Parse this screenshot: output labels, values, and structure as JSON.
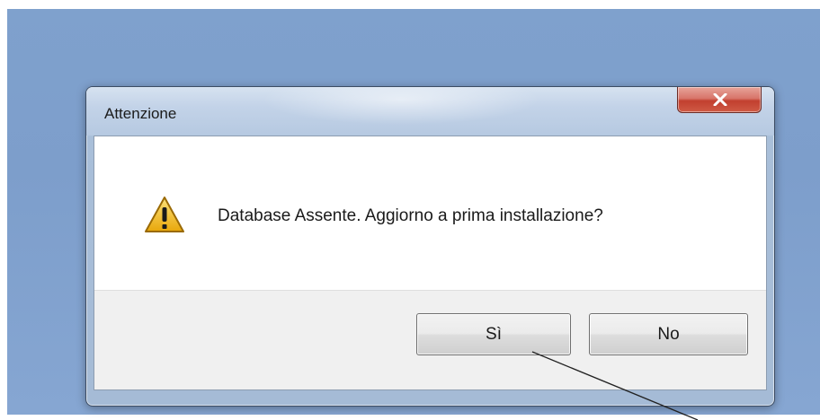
{
  "dialog": {
    "title": "Attenzione",
    "message": "Database Assente. Aggiorno a prima installazione?",
    "icon": "warning-icon",
    "buttons": {
      "yes_label": "Sì",
      "no_label": "No"
    },
    "close_icon": "close-icon"
  },
  "colors": {
    "close_button": "#c94a38",
    "desktop": "#7fa1cd",
    "warning_fill": "#f5c518"
  }
}
